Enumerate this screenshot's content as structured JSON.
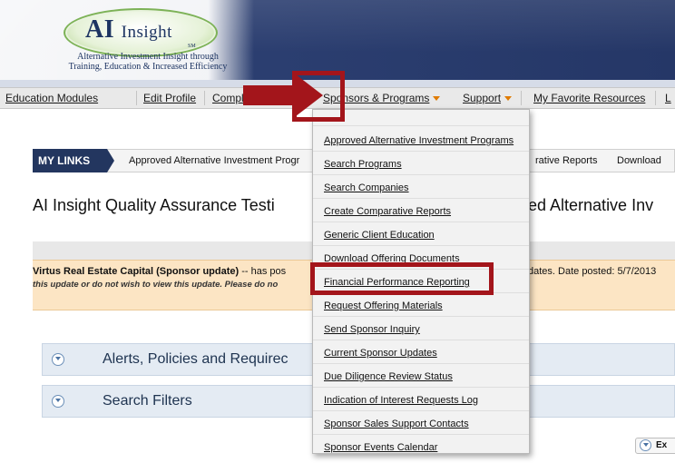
{
  "header": {
    "logo_main": "AI",
    "logo_sub": "Insight",
    "logo_mark": "SM",
    "tagline_1": "Alternative Investment Insight through",
    "tagline_2": "Training, Education & Increased Efficiency"
  },
  "nav": {
    "items": [
      "Education Modules",
      "Edit Profile",
      "Compli",
      "Sponsors & Programs",
      "Support",
      "My Favorite Resources",
      "L"
    ]
  },
  "mylinks": {
    "tab_label": "MY LINKS",
    "link_1": "Approved Alternative Investment Progr",
    "link_2": "rative Reports",
    "link_3": "Download"
  },
  "page": {
    "title_left": "AI Insight Quality Assurance Testi",
    "title_right": "ed Alternative Inv"
  },
  "update": {
    "sponsor": "Virtus Real Estate Capital (Sponsor update)",
    "text_1": " -- has pos",
    "text_right": "dates. Date posted: 5/7/2013",
    "note": "this update or do not wish to view this update. Please do no"
  },
  "panels": {
    "alerts": "Alerts, Policies and Requirec",
    "filters": "Search Filters"
  },
  "export": {
    "label": "Ex"
  },
  "dropdown": {
    "items": [
      "Approved Alternative Investment Programs",
      "Search Programs",
      "Search Companies",
      "Create Comparative Reports",
      "Generic Client Education",
      "Download Offering Documents",
      "Financial Performance Reporting",
      "Request Offering Materials",
      "Send Sponsor Inquiry",
      "Current Sponsor Updates",
      "Due Diligence Review Status",
      "Indication of Interest Requests Log",
      "Sponsor Sales Support Contacts",
      "Sponsor Events Calendar"
    ]
  },
  "colors": {
    "header_bg": "#2a3d6e",
    "highlight": "#a3151b",
    "update_bg": "#fce5c4",
    "panel_bg": "#e4ebf3",
    "caret": "#e07b00"
  }
}
